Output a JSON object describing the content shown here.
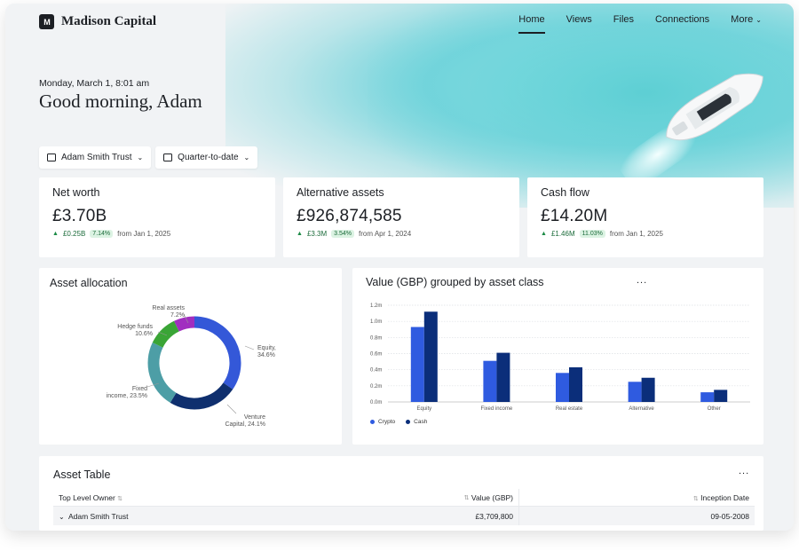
{
  "brand": {
    "name": "Madison Capital",
    "mark": "M"
  },
  "nav": {
    "items": [
      "Home",
      "Views",
      "Files",
      "Connections",
      "More"
    ],
    "active": "Home"
  },
  "header": {
    "date": "Monday, March 1, 8:01 am",
    "greeting": "Good morning, Adam"
  },
  "filters": {
    "entity": "Adam Smith Trust",
    "period": "Quarter-to-date"
  },
  "kpis": [
    {
      "title": "Net worth",
      "value": "£3.70B",
      "change": "£0.25B",
      "pct": "7.14%",
      "since": "from Jan 1, 2025"
    },
    {
      "title": "Alternative assets",
      "value": "£926,874,585",
      "change": "£3.3M",
      "pct": "3.54%",
      "since": "from Apr 1, 2024"
    },
    {
      "title": "Cash flow",
      "value": "£14.20M",
      "change": "£1.46M",
      "pct": "11.03%",
      "since": "from Jan 1, 2025"
    }
  ],
  "allocation": {
    "title": "Asset allocation",
    "labels": {
      "equity": [
        "Equity,",
        "34.6%"
      ],
      "venture": [
        "Venture",
        "Capital, 24.1%"
      ],
      "fixed": [
        "Fixed",
        "income, 23.5%"
      ],
      "hedge": [
        "Hedge funds",
        "10.6%"
      ],
      "real": [
        "Real assets",
        "7.2%"
      ]
    }
  },
  "chart_data": [
    {
      "type": "pie",
      "title": "Asset allocation",
      "categories": [
        "Equity",
        "Venture Capital",
        "Fixed income",
        "Hedge funds",
        "Real assets"
      ],
      "values": [
        34.6,
        24.1,
        23.5,
        10.6,
        7.2
      ],
      "colors": [
        "#3458d8",
        "#0f2f6e",
        "#4d9ea6",
        "#3aa536",
        "#a12ec0"
      ]
    },
    {
      "type": "bar",
      "title": "Value (GBP) grouped by asset class",
      "categories": [
        "Equity",
        "Fixed income",
        "Real estate",
        "Alternative",
        "Other"
      ],
      "series": [
        {
          "name": "Crypto",
          "values": [
            0.93,
            0.51,
            0.36,
            0.25,
            0.12
          ],
          "color": "#2f5be0"
        },
        {
          "name": "Cash",
          "values": [
            1.12,
            0.61,
            0.43,
            0.3,
            0.15
          ],
          "color": "#0b2e7a"
        }
      ],
      "y_ticks": [
        "0.0m",
        "0.2m",
        "0.4m",
        "0.6m",
        "0.8m",
        "1.0m",
        "1.2m"
      ],
      "ylim": [
        0,
        1.2
      ],
      "grid": true,
      "legend": "bottom-left"
    }
  ],
  "value_chart": {
    "title": "Value (GBP) grouped by asset class",
    "more": "..."
  },
  "table": {
    "title": "Asset Table",
    "more": "...",
    "columns": [
      "Top Level Owner",
      "Value (GBP)",
      "Inception Date"
    ],
    "rows": [
      {
        "owner": "Adam Smith Trust",
        "value": "£3,709,800",
        "date": "09-05-2008"
      }
    ]
  }
}
